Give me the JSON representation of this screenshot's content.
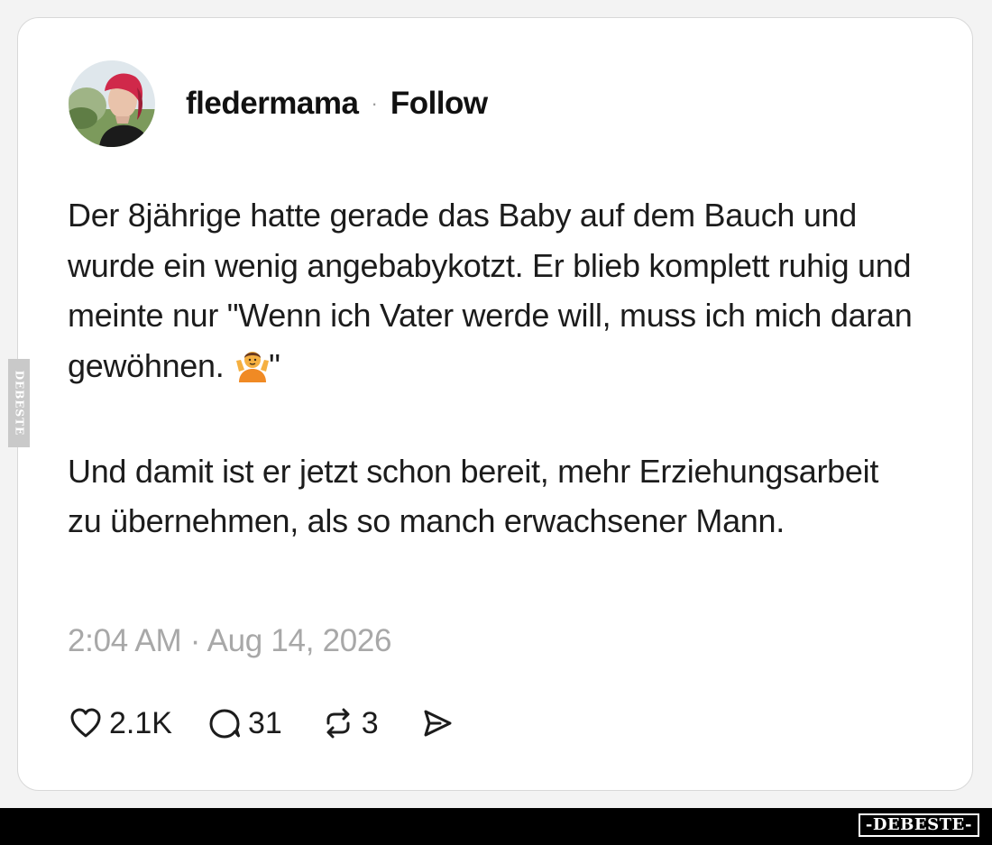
{
  "post": {
    "author": {
      "username": "fledermama",
      "separator": "·",
      "follow_label": "Follow",
      "avatar_icon": "profile-photo"
    },
    "body": {
      "paragraph_1": "Der 8jährige hatte gerade das Baby auf dem Bauch und wurde ein wenig angebabykotzt. Er blieb komplett ruhig und meinte nur \"Wenn ich Vater werde will, muss ich mich daran gewöhnen. ",
      "paragraph_1_emoji": "person-shrugging-emoji",
      "paragraph_1_end": "\"",
      "paragraph_2": "Und damit ist er jetzt schon bereit, mehr Erziehungsarbeit zu übernehmen, als so manch erwachsener Mann."
    },
    "timestamp": "2:04 AM · Aug 14, 2026",
    "actions": {
      "like": {
        "icon": "heart-icon",
        "count": "2.1K"
      },
      "reply": {
        "icon": "comment-icon",
        "count": "31"
      },
      "repost": {
        "icon": "repost-icon",
        "count": "3"
      },
      "share": {
        "icon": "share-icon"
      }
    }
  },
  "watermarks": {
    "side": "DEBESTE",
    "footer": "-DEBESTE-"
  },
  "colors": {
    "background": "#f3f3f3",
    "card": "#ffffff",
    "text": "#1c1c1c",
    "muted": "#a8a8a8",
    "emoji": "#f5a623",
    "footer": "#000000"
  }
}
